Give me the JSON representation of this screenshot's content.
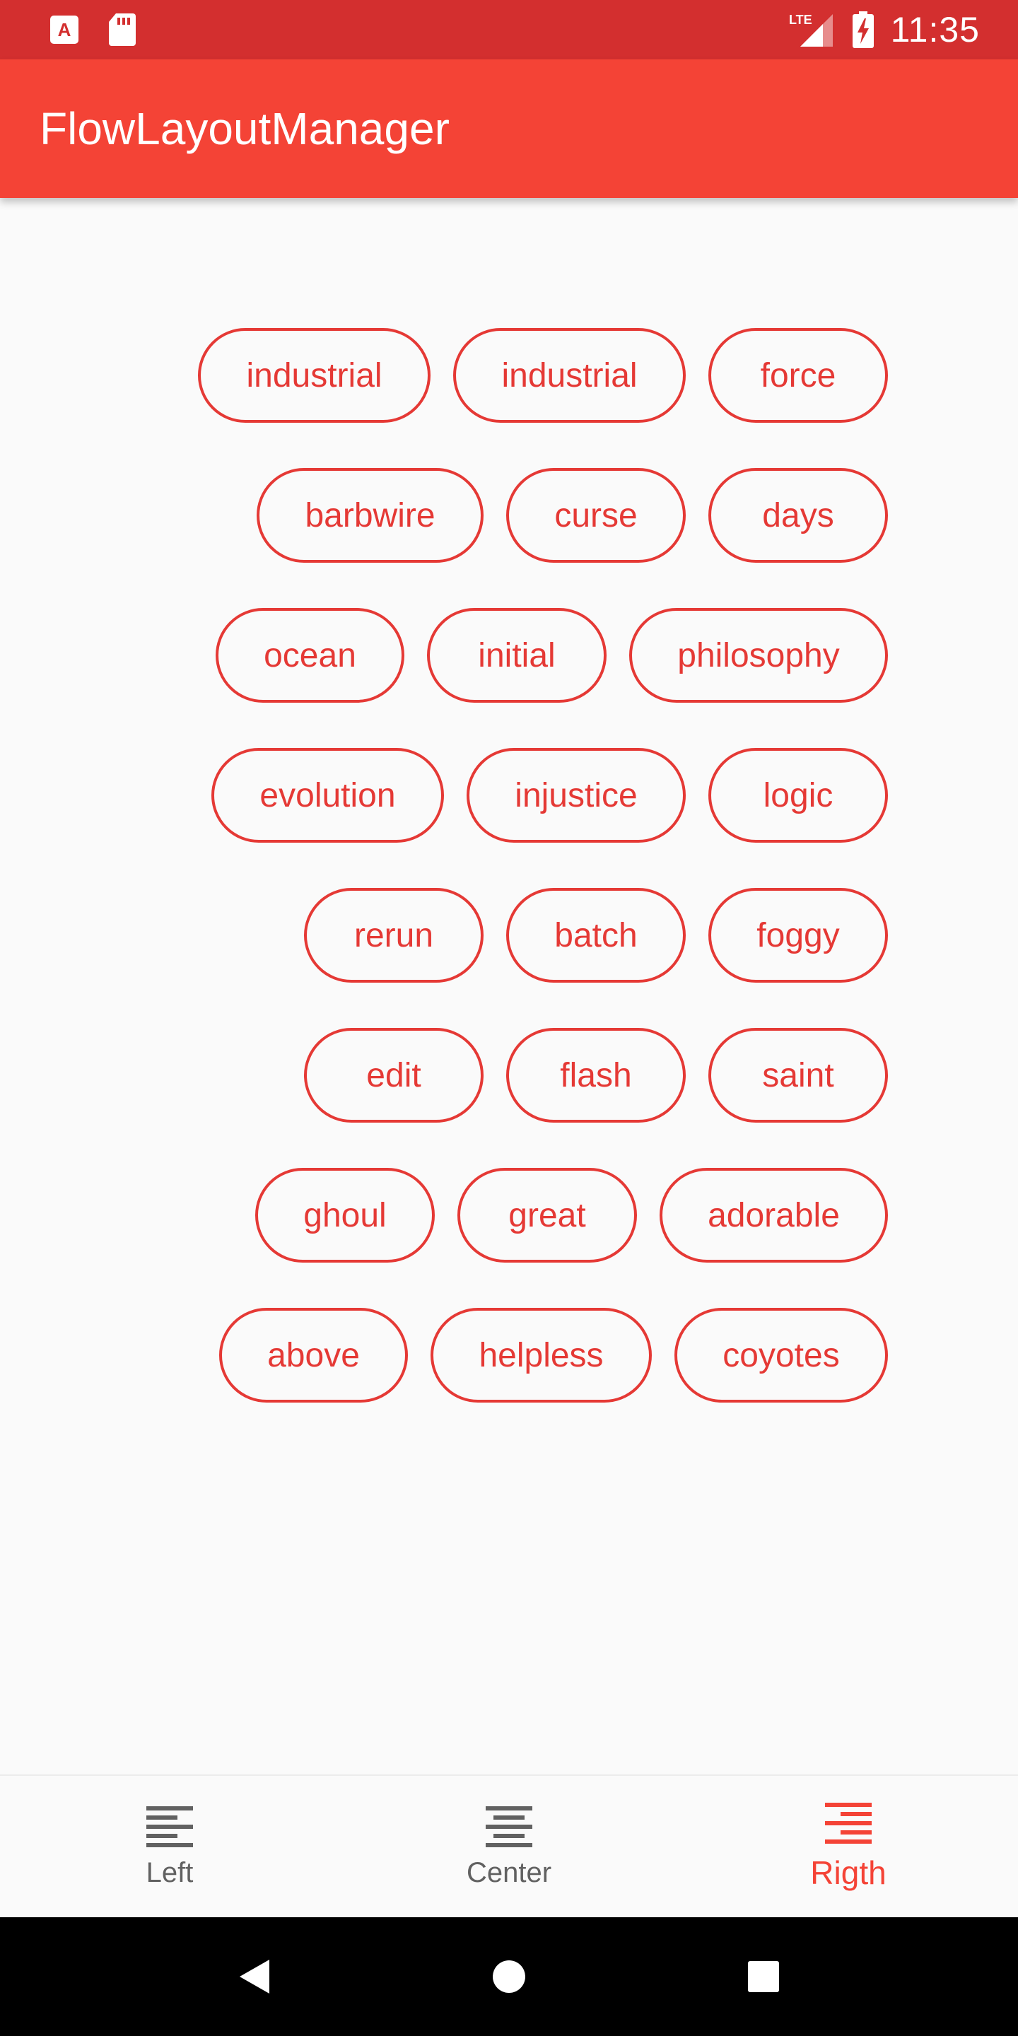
{
  "status_bar": {
    "time": "11:35",
    "network_label": "LTE",
    "icons": [
      "text-a-notification-icon",
      "sd-card-icon",
      "lte-signal-icon",
      "battery-charging-icon"
    ]
  },
  "app_bar": {
    "title": "FlowLayoutManager"
  },
  "flow": {
    "alignment": "right",
    "rows": [
      [
        "industrial",
        "industrial",
        "force"
      ],
      [
        "barbwire",
        "curse",
        "days"
      ],
      [
        "ocean",
        "initial",
        "philosophy"
      ],
      [
        "evolution",
        "injustice",
        "logic"
      ],
      [
        "rerun",
        "batch",
        "foggy"
      ],
      [
        "edit",
        "flash",
        "saint"
      ],
      [
        "ghoul",
        "great",
        "adorable"
      ],
      [
        "above",
        "helpless",
        "coyotes"
      ]
    ]
  },
  "bottom_nav": {
    "items": [
      {
        "label": "Left",
        "icon": "align-left-icon",
        "active": false
      },
      {
        "label": "Center",
        "icon": "align-center-icon",
        "active": false
      },
      {
        "label": "Rigth",
        "icon": "align-right-icon",
        "active": true
      }
    ]
  },
  "system_nav": {
    "icons": [
      "back-icon",
      "home-icon",
      "recents-icon"
    ]
  },
  "colors": {
    "status_bar": "#d32f2f",
    "app_bar": "#f44336",
    "accent": "#e53935",
    "inactive": "#616161",
    "background": "#fafafa"
  }
}
